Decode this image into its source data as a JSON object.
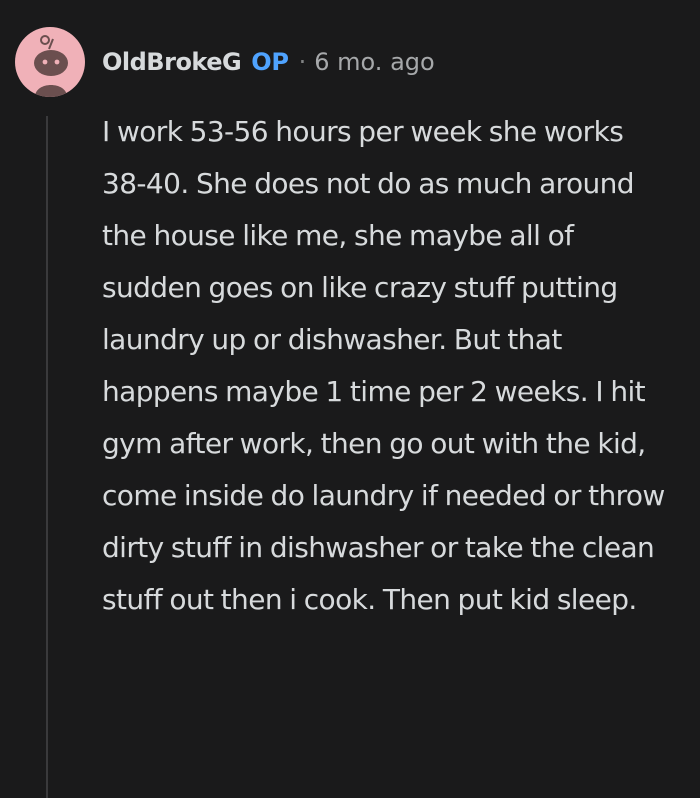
{
  "comment": {
    "author": "OldBrokeG",
    "badge": "OP",
    "separator": "·",
    "timestamp": "6 mo. ago",
    "body": "I work 53-56 hours per week she works 38-40. She does not do as much around the house like me, she maybe all of sudden goes on like crazy stuff putting laundry up or dishwasher. But that happens maybe 1 time per 2 weeks. I hit gym after work, then go out with the kid, come inside do laundry if needed or throw dirty stuff in dishwasher or take the clean stuff out then i cook. Then put kid sleep."
  },
  "avatar": {
    "icon": "reddit-snoo-icon",
    "background": "#f0b1b8",
    "figure_color": "#6b4f4f"
  },
  "colors": {
    "background": "#1a1a1b",
    "text": "#d7dadc",
    "muted": "#818384",
    "op_accent": "#4fa3ff",
    "thread_line": "#3a3a3c"
  }
}
